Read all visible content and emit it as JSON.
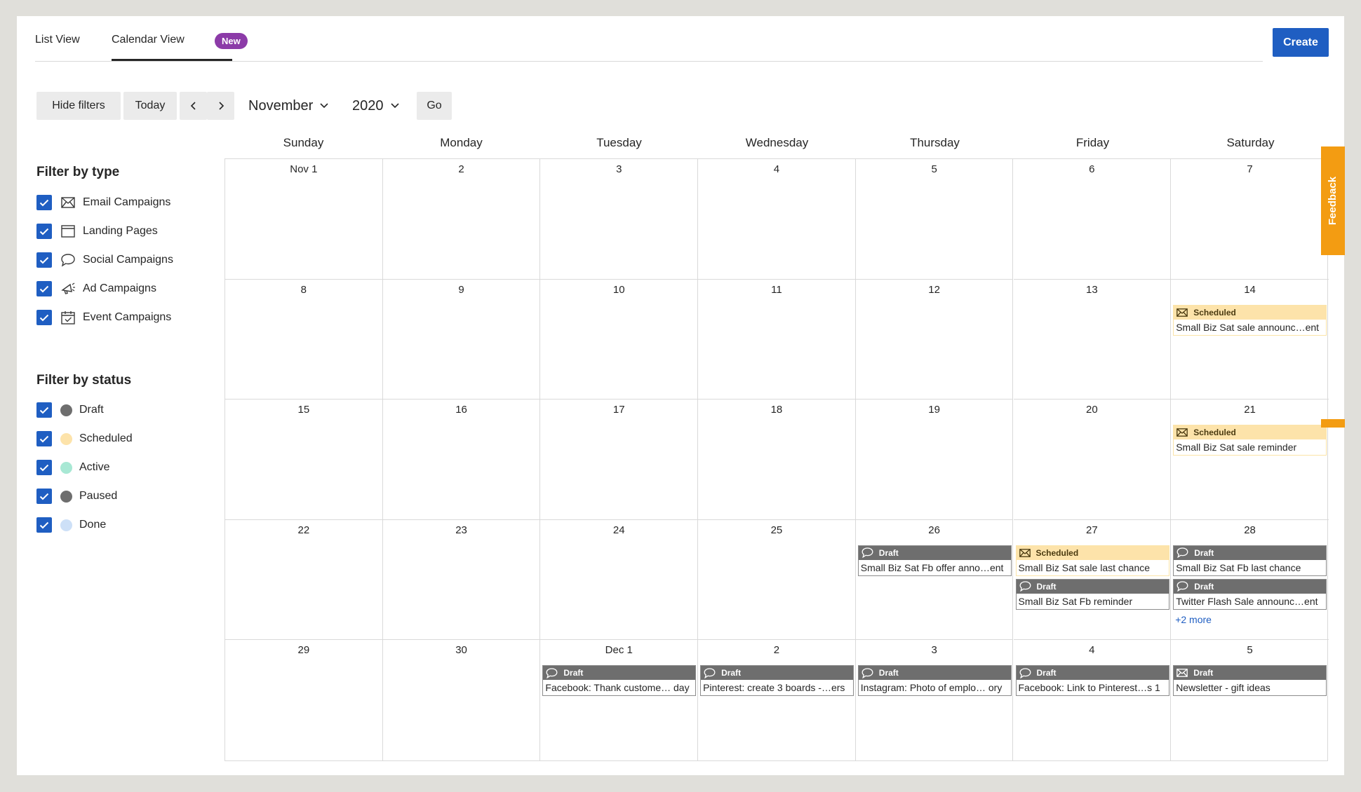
{
  "tabs": [
    {
      "label": "List View"
    },
    {
      "label": "Calendar View",
      "badge": "New"
    }
  ],
  "create_label": "Create",
  "toolbar": {
    "hide_filters": "Hide filters",
    "today": "Today",
    "prev": "‹",
    "next": "›",
    "month": "November",
    "year": "2020",
    "go": "Go"
  },
  "filters": {
    "type_title": "Filter by type",
    "types": [
      {
        "label": "Email Campaigns",
        "icon": "email-icon"
      },
      {
        "label": "Landing Pages",
        "icon": "landing-page-icon"
      },
      {
        "label": "Social Campaigns",
        "icon": "social-icon"
      },
      {
        "label": "Ad Campaigns",
        "icon": "megaphone-icon"
      },
      {
        "label": "Event Campaigns",
        "icon": "calendar-check-icon"
      }
    ],
    "status_title": "Filter by status",
    "statuses": [
      {
        "label": "Draft",
        "color": "#6e6e6e"
      },
      {
        "label": "Scheduled",
        "color": "#fde3aa"
      },
      {
        "label": "Active",
        "color": "#a8e8d4"
      },
      {
        "label": "Paused",
        "color": "#6e6e6e"
      },
      {
        "label": "Done",
        "color": "#cde0f7"
      }
    ]
  },
  "colors": {
    "accent": "#1f5ec2",
    "draft": "#6e6e6e",
    "scheduled": "#fde3aa",
    "badge": "#8c3ba8",
    "feedback": "#f39c12"
  },
  "weekdays": [
    "Sunday",
    "Monday",
    "Tuesday",
    "Wednesday",
    "Thursday",
    "Friday",
    "Saturday"
  ],
  "weeks": [
    [
      "Nov 1",
      "2",
      "3",
      "4",
      "5",
      "6",
      "7"
    ],
    [
      "8",
      "9",
      "10",
      "11",
      "12",
      "13",
      "14"
    ],
    [
      "15",
      "16",
      "17",
      "18",
      "19",
      "20",
      "21"
    ],
    [
      "22",
      "23",
      "24",
      "25",
      "26",
      "27",
      "28"
    ],
    [
      "29",
      "30",
      "Dec 1",
      "2",
      "3",
      "4",
      "5"
    ]
  ],
  "events": [
    {
      "week": 1,
      "day": 6,
      "slot": 0,
      "status": "Scheduled",
      "kind": "email",
      "title": "Small Biz Sat sale announc…ent"
    },
    {
      "week": 2,
      "day": 6,
      "slot": 0,
      "status": "Scheduled",
      "kind": "email",
      "title": "Small Biz Sat sale reminder"
    },
    {
      "week": 3,
      "day": 4,
      "slot": 0,
      "status": "Draft",
      "kind": "social",
      "title": "Small Biz Sat Fb offer anno…ent"
    },
    {
      "week": 3,
      "day": 5,
      "slot": 0,
      "status": "Scheduled",
      "kind": "email",
      "title": "Small Biz Sat sale last chance"
    },
    {
      "week": 3,
      "day": 5,
      "slot": 1,
      "status": "Draft",
      "kind": "social",
      "title": "Small Biz Sat Fb reminder"
    },
    {
      "week": 3,
      "day": 6,
      "slot": 0,
      "status": "Draft",
      "kind": "social",
      "title": "Small Biz Sat Fb last chance"
    },
    {
      "week": 3,
      "day": 6,
      "slot": 1,
      "status": "Draft",
      "kind": "social",
      "title": "Twitter Flash Sale announc…ent"
    },
    {
      "week": 4,
      "day": 2,
      "slot": 0,
      "status": "Draft",
      "kind": "social",
      "title": "Facebook: Thank custome… day"
    },
    {
      "week": 4,
      "day": 3,
      "slot": 0,
      "status": "Draft",
      "kind": "social",
      "title": "Pinterest: create 3 boards -…ers"
    },
    {
      "week": 4,
      "day": 4,
      "slot": 0,
      "status": "Draft",
      "kind": "social",
      "title": "Instagram: Photo of emplo… ory"
    },
    {
      "week": 4,
      "day": 5,
      "slot": 0,
      "status": "Draft",
      "kind": "social",
      "title": "Facebook: Link to Pinterest…s 1"
    },
    {
      "week": 4,
      "day": 6,
      "slot": 0,
      "status": "Draft",
      "kind": "email",
      "title": "Newsletter - gift ideas"
    }
  ],
  "more_links": [
    {
      "week": 3,
      "day": 6,
      "label": "+2 more"
    }
  ],
  "feedback_label": "Feedback"
}
